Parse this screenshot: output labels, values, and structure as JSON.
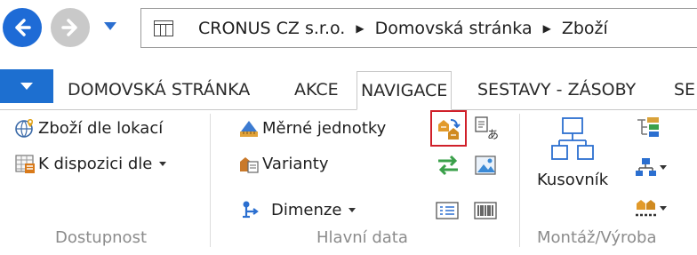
{
  "address": {
    "crumbs": [
      "CRONUS CZ s.r.o.",
      "Domovská stránka",
      "Zboží"
    ]
  },
  "tabs": [
    {
      "label": "DOMOVSKÁ STRÁNKA",
      "active": false
    },
    {
      "label": "AKCE",
      "active": false
    },
    {
      "label": "NAVIGACE",
      "active": true
    },
    {
      "label": "SESTAVY - ZÁSOBY",
      "active": false
    },
    {
      "label": "SE",
      "active": false
    }
  ],
  "groups": {
    "dostupnost": {
      "label": "Dostupnost",
      "items": [
        "Zboží dle lokací",
        "K dispozici dle"
      ]
    },
    "hlavni_data": {
      "label": "Hlavní data",
      "items": [
        "Měrné jednotky",
        "Varianty",
        "Dimenze"
      ]
    },
    "montaz": {
      "label": "Montáž/Výroba",
      "items": [
        "Kusovník"
      ]
    }
  },
  "colors": {
    "accent": "#1d6fd0",
    "highlight": "#d0202a",
    "group_label": "#8c8c8c"
  }
}
